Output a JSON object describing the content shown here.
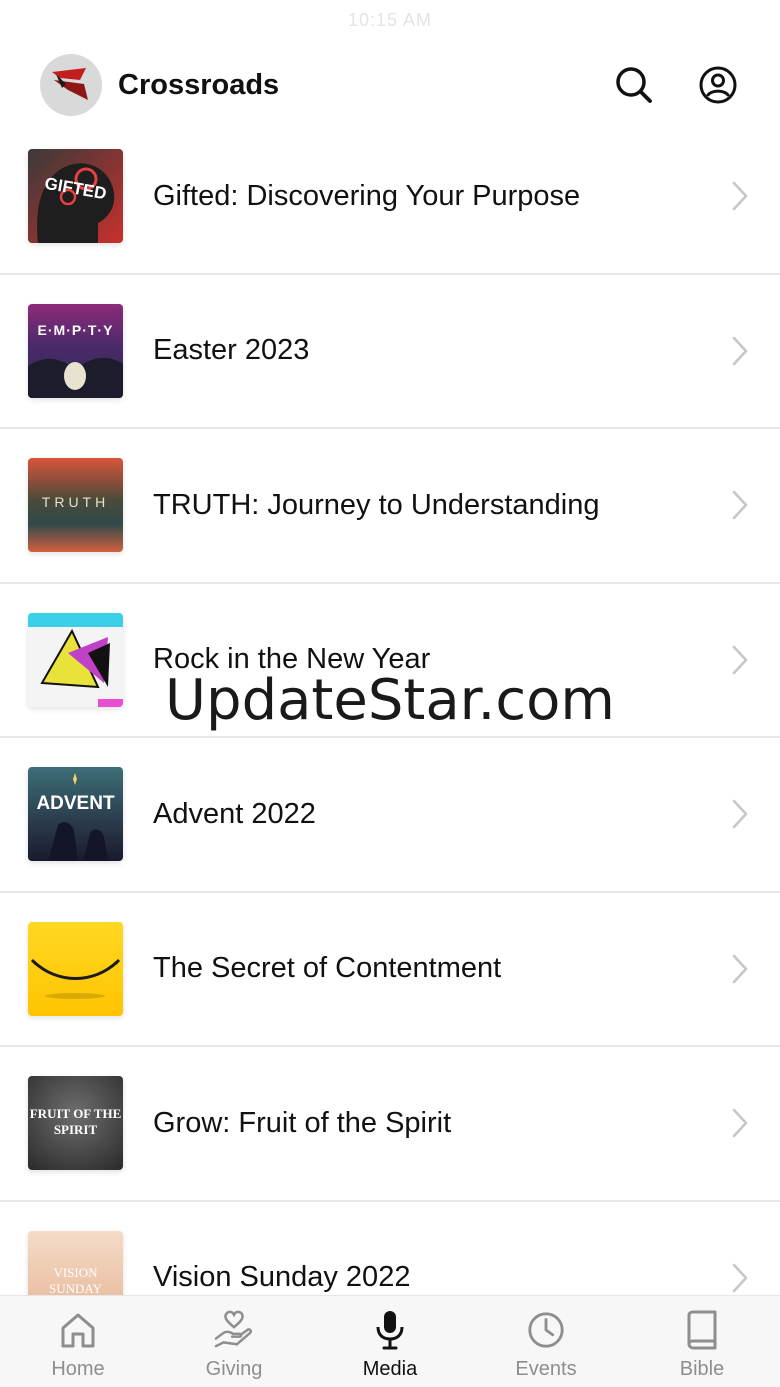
{
  "status": {
    "time": "10:15 AM"
  },
  "header": {
    "title": "Crossroads",
    "logo_icon": "crossroads-logo",
    "actions": [
      {
        "icon": "search-icon"
      },
      {
        "icon": "account-icon"
      }
    ]
  },
  "media_list": [
    {
      "title": "Gifted: Discovering Your Purpose",
      "thumb_text": "GIFTED",
      "thumb_colors": [
        "#2a2a2a",
        "#c8302c"
      ]
    },
    {
      "title": "Easter 2023",
      "thumb_text": "E·M·P·T·Y",
      "thumb_colors": [
        "#7a1f6a",
        "#2d2a5a"
      ]
    },
    {
      "title": "TRUTH: Journey to Understanding",
      "thumb_text": "TRUTH",
      "thumb_colors": [
        "#e05a3a",
        "#2f4a4a"
      ]
    },
    {
      "title": "Rock in the New Year",
      "thumb_text": "",
      "thumb_colors": [
        "#ffffff",
        "#e84fd0"
      ]
    },
    {
      "title": "Advent 2022",
      "thumb_text": "ADVENT",
      "thumb_colors": [
        "#2d5a66",
        "#1a1a3a"
      ]
    },
    {
      "title": "The Secret of Contentment",
      "thumb_text": "",
      "thumb_colors": [
        "#ffd21a",
        "#ffc400"
      ]
    },
    {
      "title": "Grow: Fruit of the Spirit",
      "thumb_text": "FRUIT OF THE SPIRIT",
      "thumb_colors": [
        "#5a5a5a",
        "#2a2a2a"
      ]
    },
    {
      "title": "Vision Sunday 2022",
      "thumb_text": "VISION SUNDAY",
      "thumb_colors": [
        "#f2d7c2",
        "#e8b99a"
      ]
    }
  ],
  "watermark": "UpdateStar.com",
  "tabs": [
    {
      "label": "Home",
      "icon": "home-icon",
      "active": false
    },
    {
      "label": "Giving",
      "icon": "giving-icon",
      "active": false
    },
    {
      "label": "Media",
      "icon": "microphone-icon",
      "active": true
    },
    {
      "label": "Events",
      "icon": "clock-icon",
      "active": false
    },
    {
      "label": "Bible",
      "icon": "book-icon",
      "active": false
    }
  ],
  "colors": {
    "accent": "#111111",
    "inactive": "#8e8e8e",
    "divider": "#e8e8e8",
    "tabbar_bg": "#f7f7f7"
  }
}
